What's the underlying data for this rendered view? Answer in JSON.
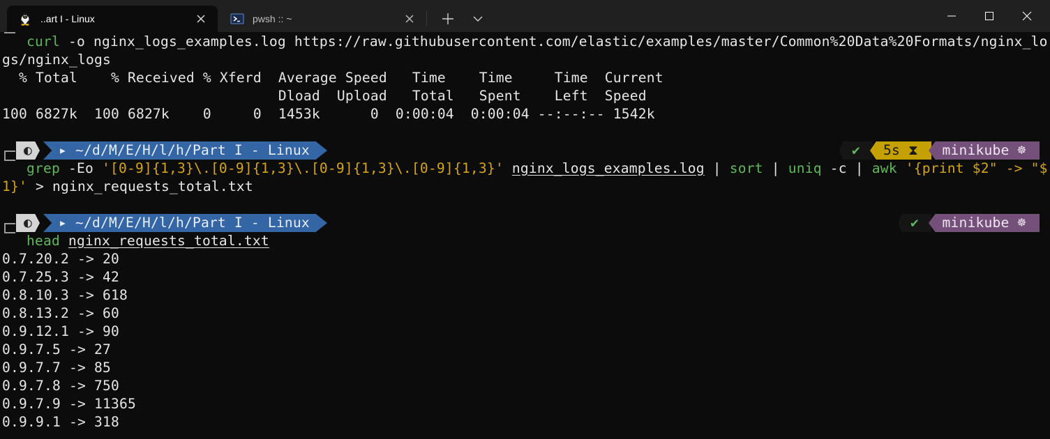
{
  "tabs": [
    {
      "title": "..art I - Linux",
      "icon": "linux-penguin-icon",
      "active": true
    },
    {
      "title": "pwsh :: ~",
      "icon": "powershell-icon",
      "active": false
    }
  ],
  "window_controls": [
    "minimize-icon",
    "maximize-icon",
    "close-icon"
  ],
  "terminal": {
    "curl_line1": {
      "cmd": "curl",
      "rest": " -o nginx_logs_examples.log https://raw.githubusercontent.com/elastic/examples/master/Common%20Data%20Formats/nginx_lo"
    },
    "curl_line2": "gs/nginx_logs",
    "curl_header1": "  % Total    % Received % Xferd  Average Speed   Time    Time     Time  Current",
    "curl_header2": "                                 Dload  Upload   Total   Spent    Left  Speed",
    "curl_progress": "100 6827k  100 6827k    0     0  1453k      0  0:00:04  0:00:04 --:--:-- 1542k",
    "prompt1": {
      "os_glyph": "◐",
      "path": "▸ ~/d/M/E/H/l/h/Part I - Linux",
      "status": "✔",
      "duration": "5s ⧗",
      "kube": "minikube ☸"
    },
    "grep_line1": {
      "cmd1": "grep",
      "flags": " -Eo ",
      "pattern": "'[0-9]{1,3}\\.[0-9]{1,3}\\.[0-9]{1,3}\\.[0-9]{1,3}'",
      "file": "nginx_logs_examples.log",
      "pipe1": " | ",
      "cmd2": "sort",
      "pipe2": " | ",
      "cmd3": "uniq",
      "flag3": " -c | ",
      "cmd4": "awk",
      "awk_arg": " '{print $2\" -> \"$"
    },
    "grep_line2": {
      "awk_tail": "1}'",
      "redirect": " > nginx_requests_total.txt"
    },
    "prompt2": {
      "os_glyph": "◐",
      "path": "▸ ~/d/M/E/H/l/h/Part I - Linux",
      "status": "✔",
      "kube": "minikube ☸"
    },
    "head_line": {
      "cmd": "head",
      "file": "nginx_requests_total.txt"
    },
    "output": [
      "0.7.20.2 -> 20",
      "0.7.25.3 -> 42",
      "0.8.10.3 -> 618",
      "0.8.13.2 -> 60",
      "0.9.12.1 -> 90",
      "0.9.7.5 -> 27",
      "0.9.7.7 -> 85",
      "0.9.7.8 -> 750",
      "0.9.7.9 -> 11365",
      "0.9.9.1 -> 318"
    ]
  }
}
